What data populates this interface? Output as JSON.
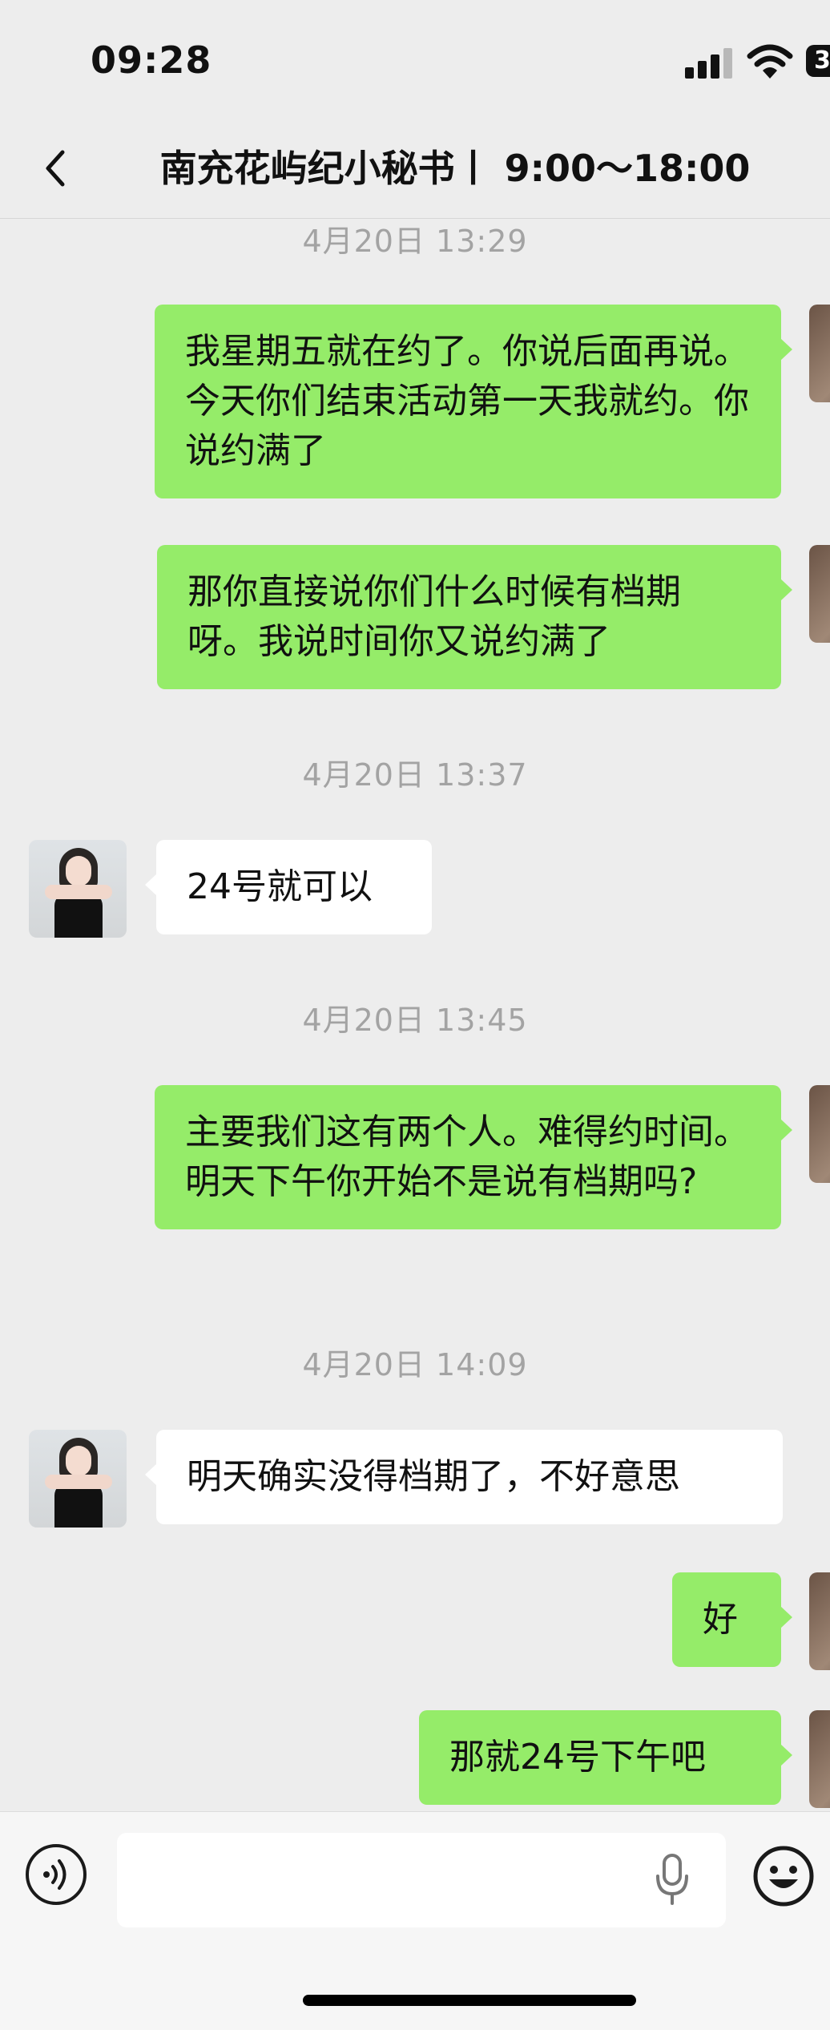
{
  "status_bar": {
    "time": "09:28",
    "battery_text": "3"
  },
  "nav": {
    "title": "南充花屿纪小秘书丨 9:00～18:00"
  },
  "messages": [
    {
      "type": "timestamp",
      "text": "4月20日 13:29"
    },
    {
      "type": "me",
      "text": "我星期五就在约了。你说后面再说。今天你们结束活动第一天我就约。你说约满了"
    },
    {
      "type": "me",
      "text": "那你直接说你们什么时候有档期呀。我说时间你又说约满了"
    },
    {
      "type": "timestamp",
      "text": "4月20日 13:37"
    },
    {
      "type": "them",
      "text": "24号就可以"
    },
    {
      "type": "timestamp",
      "text": "4月20日 13:45"
    },
    {
      "type": "me",
      "text": "主要我们这有两个人。难得约时间。明天下午你开始不是说有档期吗?"
    },
    {
      "type": "timestamp",
      "text": "4月20日 14:09"
    },
    {
      "type": "them",
      "text": "明天确实没得档期了，不好意思"
    },
    {
      "type": "me",
      "text": "好"
    },
    {
      "type": "me",
      "text": "那就24号下午吧"
    }
  ],
  "input": {
    "value": "",
    "placeholder": ""
  },
  "colors": {
    "my_bubble": "#95ec69",
    "their_bubble": "#ffffff",
    "background": "#ededed",
    "timestamp": "#a3a3a3"
  }
}
